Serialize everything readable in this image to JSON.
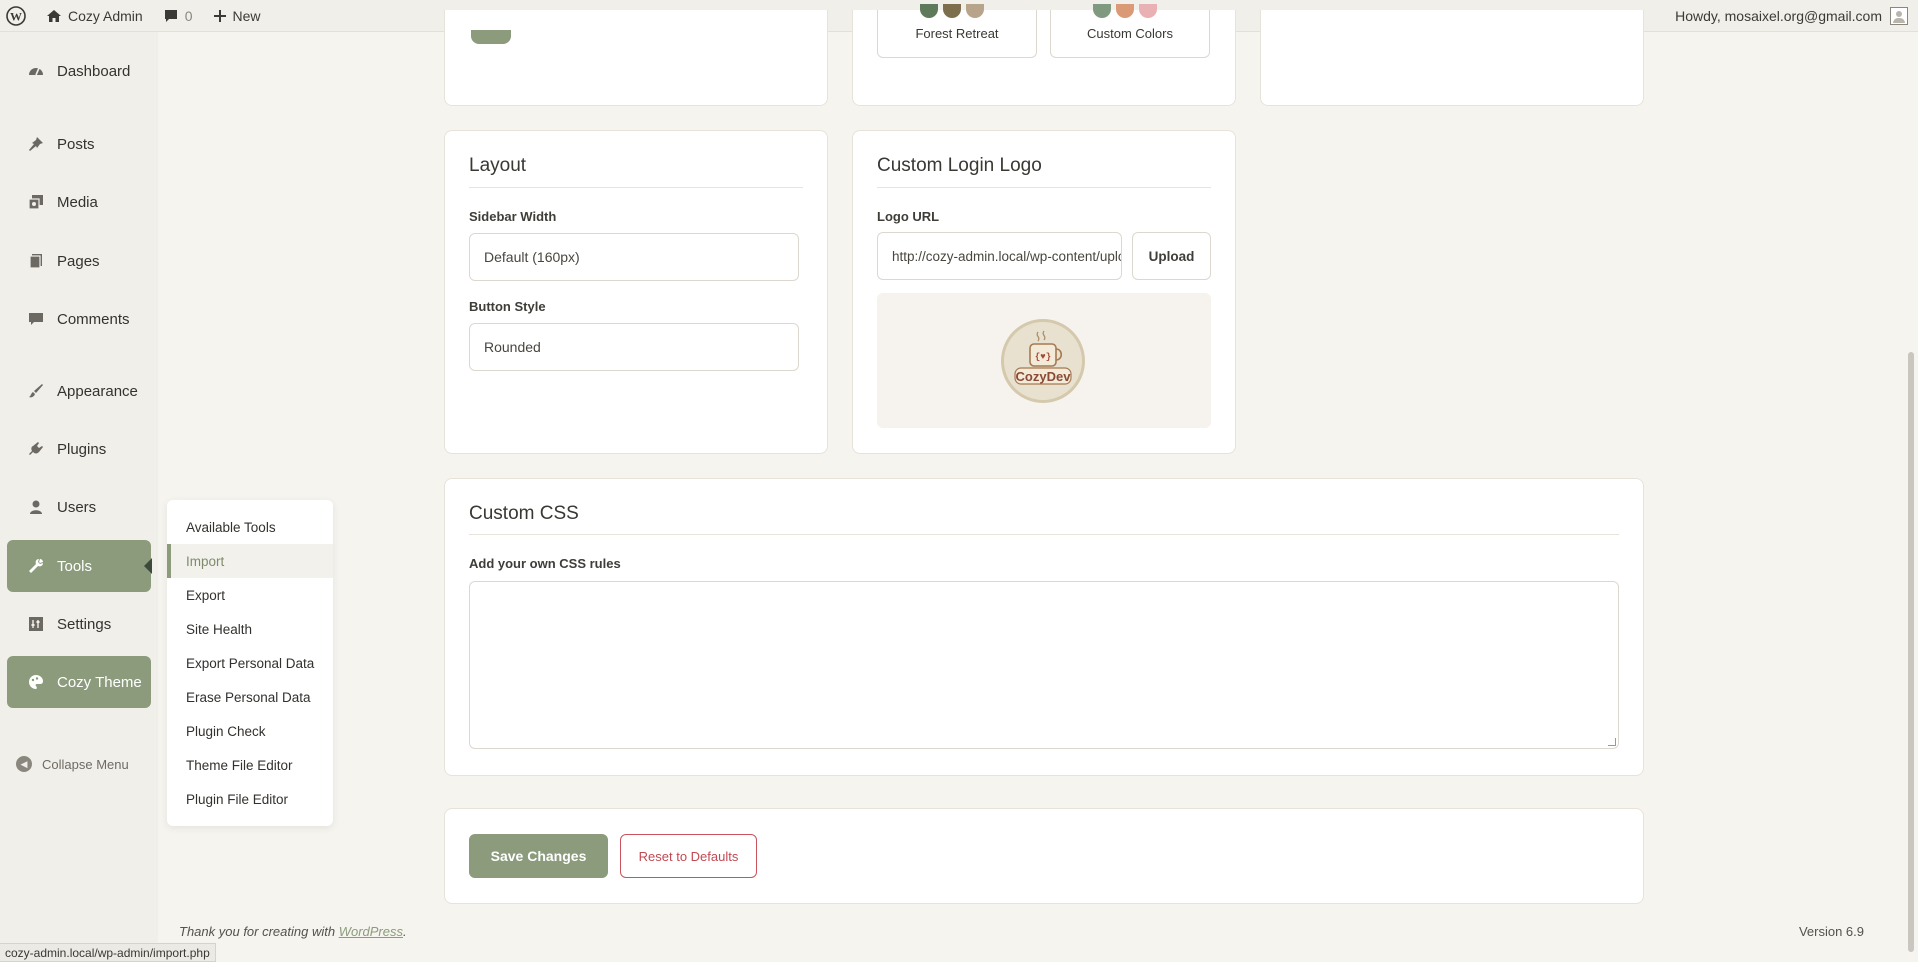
{
  "adminbar": {
    "site_name": "Cozy Admin",
    "comments_count": "0",
    "new_label": "New",
    "howdy": "Howdy, mosaixel.org@gmail.com"
  },
  "sidebar": {
    "items": [
      {
        "label": "Dashboard",
        "icon": "dashboard-icon"
      },
      {
        "label": "Posts",
        "icon": "pin-icon"
      },
      {
        "label": "Media",
        "icon": "media-icon"
      },
      {
        "label": "Pages",
        "icon": "pages-icon"
      },
      {
        "label": "Comments",
        "icon": "comment-icon"
      },
      {
        "label": "Appearance",
        "icon": "brush-icon"
      },
      {
        "label": "Plugins",
        "icon": "plugin-icon"
      },
      {
        "label": "Users",
        "icon": "user-icon"
      },
      {
        "label": "Tools",
        "icon": "wrench-icon"
      },
      {
        "label": "Settings",
        "icon": "settings-icon"
      },
      {
        "label": "Cozy Theme",
        "icon": "palette-icon"
      }
    ],
    "collapse_label": "Collapse Menu"
  },
  "tools_flyout": {
    "items": [
      "Available Tools",
      "Import",
      "Export",
      "Site Health",
      "Export Personal Data",
      "Erase Personal Data",
      "Plugin Check",
      "Theme File Editor",
      "Plugin File Editor"
    ],
    "current": "Import"
  },
  "presets": {
    "items": [
      {
        "name": "Forest Retreat",
        "colors": [
          "#5e7a5a",
          "#7d6e4e",
          "#b7a48a"
        ]
      },
      {
        "name": "Custom Colors",
        "colors": [
          "#7f9a7e",
          "#d99a75",
          "#eab1b5"
        ]
      }
    ]
  },
  "layout_card": {
    "title": "Layout",
    "sidebar_width_label": "Sidebar Width",
    "sidebar_width_value": "Default (160px)",
    "button_style_label": "Button Style",
    "button_style_value": "Rounded"
  },
  "login_logo_card": {
    "title": "Custom Login Logo",
    "logo_url_label": "Logo URL",
    "logo_url_value": "http://cozy-admin.local/wp-content/uploads/cozydev-logo.png",
    "upload_label": "Upload",
    "logo_text": "CozyDev"
  },
  "css_card": {
    "title": "Custom CSS",
    "label": "Add your own CSS rules",
    "value": ""
  },
  "actions": {
    "save_label": "Save Changes",
    "reset_label": "Reset to Defaults"
  },
  "footer": {
    "thanks_prefix": "Thank you for creating with ",
    "thanks_link": "WordPress",
    "thanks_suffix": ".",
    "version": "Version 6.9"
  },
  "status_url": "cozy-admin.local/wp-admin/import.php",
  "colors": {
    "accent": "#8b9b7c",
    "danger": "#c9545d",
    "background": "#f6f4ef"
  }
}
